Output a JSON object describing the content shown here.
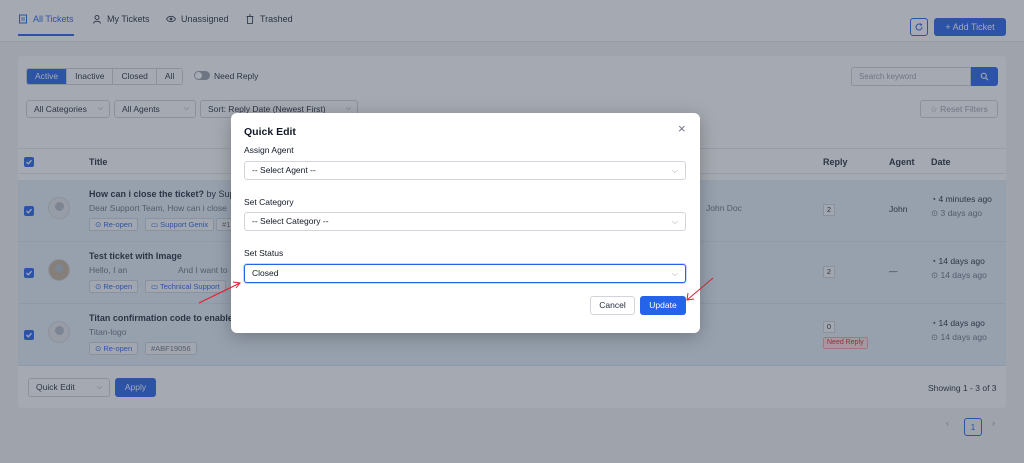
{
  "header": {
    "tabs": [
      {
        "label": "All Tickets",
        "icon": "inbox-icon",
        "active": true
      },
      {
        "label": "My Tickets",
        "icon": "user-icon",
        "active": false
      },
      {
        "label": "Unassigned",
        "icon": "eye-icon",
        "active": false
      },
      {
        "label": "Trashed",
        "icon": "trash-icon",
        "active": false
      }
    ],
    "add_ticket_label": "+ Add Ticket"
  },
  "filters": {
    "status_tabs": [
      "Active",
      "Inactive",
      "Closed",
      "All"
    ],
    "active_status": "Active",
    "need_reply_label": "Need Reply",
    "search_placeholder": "Search keyword",
    "category_select": "All Categories",
    "agent_select": "All Agents",
    "sort_select": "Sort: Reply Date (Newest First)",
    "reset_label": "Reset Filters"
  },
  "table": {
    "columns": [
      "Title",
      "Reply",
      "Agent",
      "Date"
    ],
    "rows": [
      {
        "title": "How can i close the ticket?",
        "title_suffix": "by Suppo",
        "preview": "Dear Support Team, How can i close",
        "preview_right": "John Doc",
        "tags": [
          "Re-open",
          "Support Genix",
          "#1"
        ],
        "reply": "2",
        "agent": "John",
        "date_main": "4 minutes ago",
        "date_sub": "3 days ago"
      },
      {
        "title": "Test ticket with Image",
        "preview": "Hello, I an",
        "preview_mid": "And I want to",
        "tags": [
          "Re-open",
          "Technical Support"
        ],
        "reply": "2",
        "agent": "—",
        "date_main": "14 days ago",
        "date_sub": "14 days ago"
      },
      {
        "title": "Titan confirmation code to enable fo",
        "preview": "Titan-logo",
        "tags": [
          "Re-open",
          "#ABF19056"
        ],
        "reply": "0",
        "badge": "Need Reply",
        "date_main": "14 days ago",
        "date_sub": "14 days ago"
      }
    ]
  },
  "footer": {
    "bulk_action": "Quick Edit",
    "apply_label": "Apply",
    "showing": "Showing 1 - 3 of 3",
    "current_page": "1"
  },
  "modal": {
    "title": "Quick Edit",
    "close_glyph": "×",
    "assign_agent_label": "Assign Agent",
    "assign_agent_value": "-- Select Agent --",
    "set_category_label": "Set Category",
    "set_category_value": "-- Select Category --",
    "set_status_label": "Set Status",
    "set_status_value": "Closed",
    "cancel_label": "Cancel",
    "update_label": "Update"
  },
  "colors": {
    "accent": "#2563eb",
    "annotation_arrow": "#e11d2e",
    "selected_row": "#e6f0fa",
    "need_reply": "#dc2626"
  }
}
